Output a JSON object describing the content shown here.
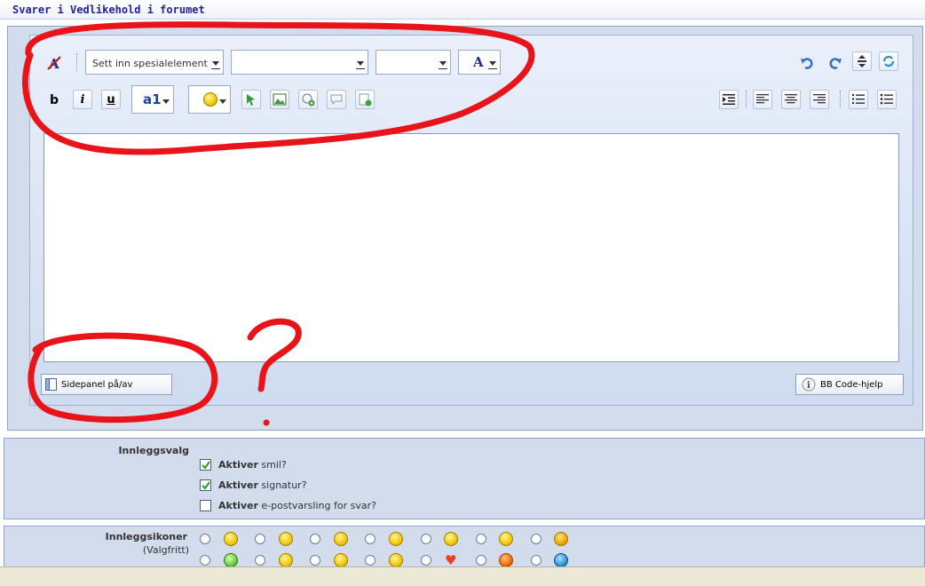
{
  "page": {
    "title": "Svarer i Vedlikehold i forumet"
  },
  "toolbar": {
    "special_element_label": "Sett inn spesialelement",
    "font_value": "",
    "size_value": "",
    "color_letter": "A",
    "bold_label": "b",
    "italic_label": "i",
    "underline_label": "u",
    "highlight_label": "a1"
  },
  "footer": {
    "sidepanel_label": "Sidepanel på/av",
    "bbcode_help_label": "BB Code-hjelp"
  },
  "options": {
    "section_label": "Innleggsvalg",
    "items": [
      {
        "bold": "Aktiver",
        "text": " smil?",
        "checked": true
      },
      {
        "bold": "Aktiver",
        "text": " signatur?",
        "checked": true
      },
      {
        "bold": "Aktiver",
        "text": " e-postvarsling for svar?",
        "checked": false
      }
    ]
  },
  "post_icons": {
    "section_label": "Innleggsikoner",
    "sub_label": "(Valgfritt)",
    "row1": [
      "smile-icon",
      "grin-icon",
      "sleepy-icon",
      "tongue-icon",
      "shocked-icon",
      "laugh-icon",
      "angry-icon"
    ],
    "row2": [
      "sick-icon",
      "confused-icon",
      "cool-icon",
      "arrow-icon",
      "heart-icon",
      "warning-icon",
      "question-icon"
    ]
  },
  "annotation": {
    "question_mark": "?",
    "stroke_color": "#e8141a"
  },
  "colors": {
    "title_text": "#22229c",
    "panel_bg": "#d3dcec",
    "border": "#8fa3c4"
  }
}
